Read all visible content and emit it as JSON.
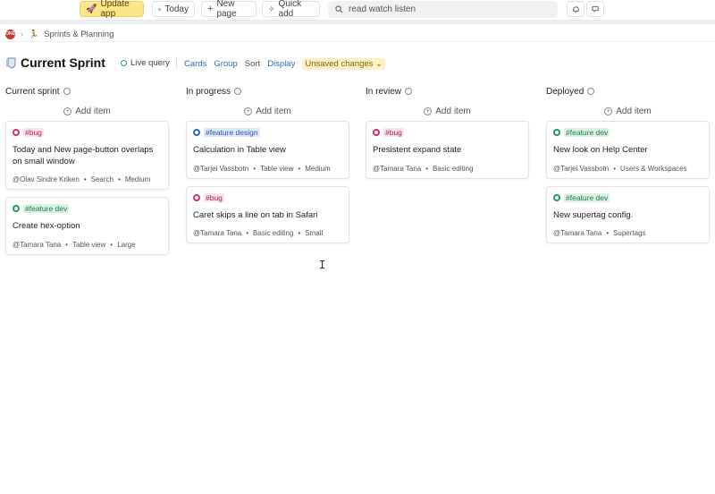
{
  "toolbar": {
    "update_label": "Update app",
    "update_icon": "rocket-icon",
    "today_label": "Today",
    "new_page_label": "New page",
    "quick_add_label": "Quick add",
    "search_value": "read watch listen"
  },
  "breadcrumb": {
    "workspace_logo_text": "ONE",
    "page": "Sprints & Planning"
  },
  "view": {
    "title": "Current Sprint",
    "live_query": "Live query",
    "options": [
      "Cards",
      "Group",
      "Sort",
      "Display"
    ],
    "unsaved": "Unsaved changes",
    "add_item": "Add item"
  },
  "colors": {
    "bug": "#d8315b",
    "feature_design": "#2f63d4",
    "feature_dev": "#229a5e",
    "accent_blue": "#2d6fb7",
    "update_bg": "#fbe58a"
  },
  "columns": [
    {
      "name": "Current sprint",
      "cards": [
        {
          "tag": "#bug",
          "tag_type": "bug",
          "title": "Today and New page-button overlaps on small window",
          "meta": [
            "@Olav Sindre Kriken",
            "Search",
            "Medium"
          ]
        },
        {
          "tag": "#feature dev",
          "tag_type": "feature_dev",
          "title": "Create hex-option",
          "meta": [
            "@Tamara Tana",
            "Table view",
            "Large"
          ]
        }
      ]
    },
    {
      "name": "In progress",
      "cards": [
        {
          "tag": "#feature design",
          "tag_type": "feature_design",
          "title": "Calculation in Table view",
          "meta": [
            "@Tarjei Vassbotn",
            "Table view",
            "Medium"
          ]
        },
        {
          "tag": "#bug",
          "tag_type": "bug",
          "title": "Caret skips a line on tab in Safari",
          "meta": [
            "@Tamara Tana",
            "Basic editing",
            "Small"
          ]
        }
      ]
    },
    {
      "name": "In review",
      "cards": [
        {
          "tag": "#bug",
          "tag_type": "bug",
          "title": "Presistent expand state",
          "meta": [
            "@Tamara Tana",
            "Basic editing"
          ]
        }
      ]
    },
    {
      "name": "Deployed",
      "cards": [
        {
          "tag": "#feature dev",
          "tag_type": "feature_dev",
          "title": "New look on Help Center",
          "meta": [
            "@Tarjei Vassbotn",
            "Users & Workspaces"
          ]
        },
        {
          "tag": "#feature dev",
          "tag_type": "feature_dev",
          "title": "New supertag config.",
          "meta": [
            "@Tamara Tana",
            "Supertags"
          ]
        }
      ]
    }
  ]
}
